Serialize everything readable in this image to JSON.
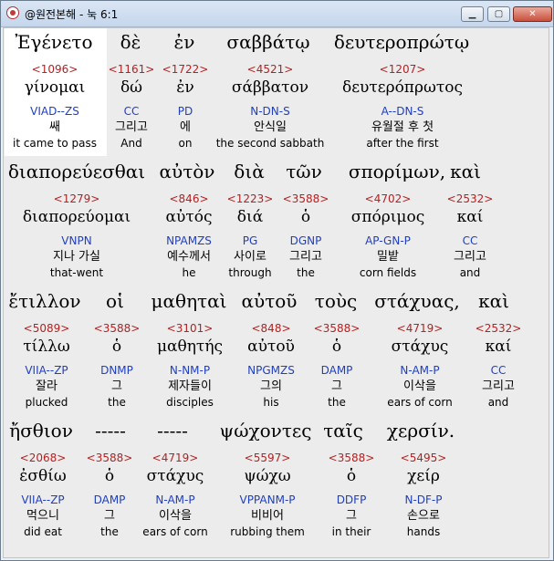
{
  "window": {
    "title": "@원전본해 - 눅 6:1",
    "minimize_label": "▁",
    "maximize_label": "▢",
    "close_label": "✕",
    "app_icon": "app-icon"
  },
  "rows": [
    {
      "greek": [
        {
          "text": "Ἐγένετο"
        },
        {
          "text": "δὲ"
        },
        {
          "text": "ἐν"
        },
        {
          "text": "σαββάτῳ"
        },
        {
          "text": "δευτεροπρώτῳ"
        }
      ],
      "cells": [
        {
          "strong": "<1096>",
          "lemma": "γίνομαι",
          "parse": "VIAD--ZS",
          "kor": "쌔",
          "eng": "it came to pass"
        },
        {
          "strong": "<1161>",
          "lemma": "δώ",
          "parse": "CC",
          "kor": "그리고",
          "eng": "And"
        },
        {
          "strong": "<1722>",
          "lemma": "ἐν",
          "parse": "PD",
          "kor": "에",
          "eng": "on"
        },
        {
          "strong": "<4521>",
          "lemma": "σάββατον",
          "parse": "N-DN-S",
          "kor": "안식일",
          "eng": "the second sabbath"
        },
        {
          "strong": "<1207>",
          "lemma": "δευτερόπρωτος",
          "parse": "A--DN-S",
          "kor": "유월절 후 첫",
          "eng": "after the first"
        }
      ]
    },
    {
      "greek": [
        {
          "text": "διαπορεύεσθαι"
        },
        {
          "text": "αὐτὸν"
        },
        {
          "text": "διὰ"
        },
        {
          "text": "τῶν"
        },
        {
          "text": "σπορίμων,"
        },
        {
          "text": "καὶ"
        }
      ],
      "cells": [
        {
          "strong": "<1279>",
          "lemma": "διαπορεύομαι",
          "parse": "VNPN",
          "kor": "지나 가실",
          "eng": "that-went"
        },
        {
          "strong": "<846>",
          "lemma": "αὐτός",
          "parse": "NPAMZS",
          "kor": "예수께서",
          "eng": "he"
        },
        {
          "strong": "<1223>",
          "lemma": "διά",
          "parse": "PG",
          "kor": "사이로",
          "eng": "through"
        },
        {
          "strong": "<3588>",
          "lemma": "ὁ",
          "parse": "DGNP",
          "kor": "그리고",
          "eng": "the"
        },
        {
          "strong": "<4702>",
          "lemma": "σπόριμος",
          "parse": "AP-GN-P",
          "kor": "밀밭",
          "eng": "corn fields"
        },
        {
          "strong": "<2532>",
          "lemma": "καί",
          "parse": "CC",
          "kor": "그리고",
          "eng": "and"
        }
      ]
    },
    {
      "greek": [
        {
          "text": "ἔτιλλον"
        },
        {
          "text": "οἱ"
        },
        {
          "text": "μαθηταὶ"
        },
        {
          "text": "αὐτοῦ"
        },
        {
          "text": "τοὺς"
        },
        {
          "text": "στάχυας,"
        },
        {
          "text": "καὶ"
        }
      ],
      "cells": [
        {
          "strong": "<5089>",
          "lemma": "τίλλω",
          "parse": "VIIA--ZP",
          "kor": "잘라",
          "eng": "plucked"
        },
        {
          "strong": "<3588>",
          "lemma": "ὁ",
          "parse": "DNMP",
          "kor": "그",
          "eng": "the"
        },
        {
          "strong": "<3101>",
          "lemma": "μαθητής",
          "parse": "N-NM-P",
          "kor": "제자들이",
          "eng": "disciples"
        },
        {
          "strong": "<848>",
          "lemma": "αὐτοῦ",
          "parse": "NPGMZS",
          "kor": "그의",
          "eng": "his"
        },
        {
          "strong": "<3588>",
          "lemma": "ὁ",
          "parse": "DAMP",
          "kor": "그",
          "eng": "the"
        },
        {
          "strong": "<4719>",
          "lemma": "στάχυς",
          "parse": "N-AM-P",
          "kor": "이삭을",
          "eng": "ears of corn"
        },
        {
          "strong": "<2532>",
          "lemma": "καί",
          "parse": "CC",
          "kor": "그리고",
          "eng": "and"
        }
      ]
    },
    {
      "greek": [
        {
          "text": "ἤσθιον"
        },
        {
          "text": "-----"
        },
        {
          "text": "-----"
        },
        {
          "text": "ψώχοντες"
        },
        {
          "text": "ταῖς"
        },
        {
          "text": "χερσίν."
        }
      ],
      "cells": [
        {
          "strong": "<2068>",
          "lemma": "ἐσθίω",
          "parse": "VIIA--ZP",
          "kor": "먹으니",
          "eng": "did eat"
        },
        {
          "strong": "<3588>",
          "lemma": "ὁ",
          "parse": "DAMP",
          "kor": "그",
          "eng": "the"
        },
        {
          "strong": "<4719>",
          "lemma": "στάχυς",
          "parse": "N-AM-P",
          "kor": "이삭을",
          "eng": "ears of corn"
        },
        {
          "strong": "<5597>",
          "lemma": "ψώχω",
          "parse": "VPPANM-P",
          "kor": "비비어",
          "eng": "rubbing them"
        },
        {
          "strong": "<3588>",
          "lemma": "ὁ",
          "parse": "DDFP",
          "kor": "그",
          "eng": "in their"
        },
        {
          "strong": "<5495>",
          "lemma": "χείρ",
          "parse": "N-DF-P",
          "kor": "손으로",
          "eng": "hands"
        }
      ]
    }
  ]
}
